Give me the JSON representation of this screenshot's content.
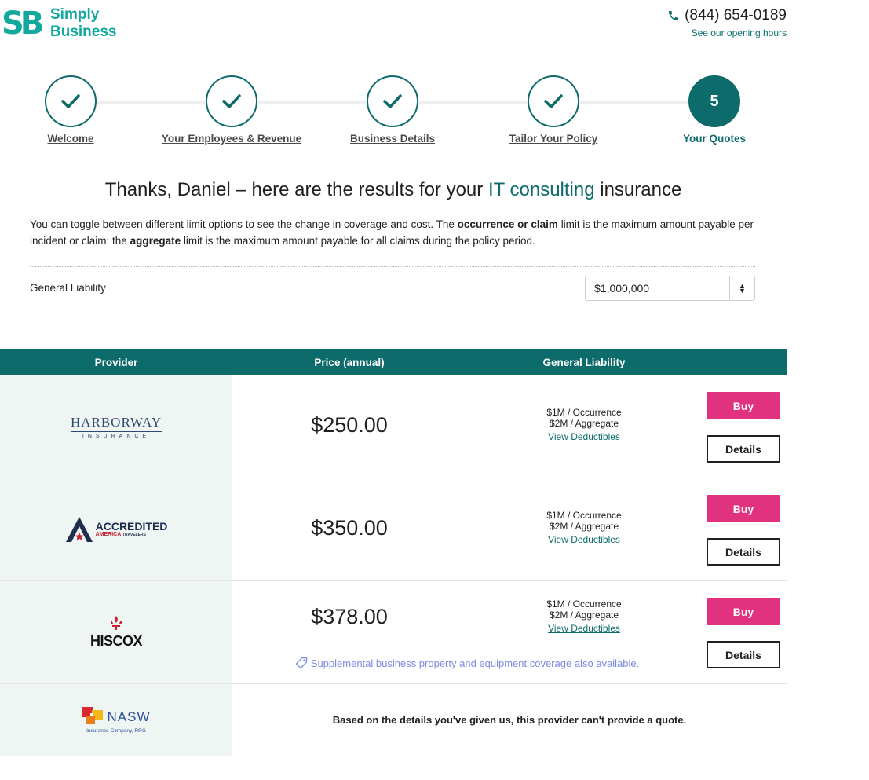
{
  "header": {
    "logo_mark": "SB",
    "logo_line1": "Simply",
    "logo_line2": "Business",
    "phone": "(844) 654-0189",
    "hours_link": "See our opening hours"
  },
  "stepper": {
    "steps": [
      {
        "label": "Welcome",
        "state": "complete"
      },
      {
        "label": "Your Employees & Revenue",
        "state": "complete"
      },
      {
        "label": "Business Details",
        "state": "complete"
      },
      {
        "label": "Tailor Your Policy",
        "state": "complete"
      },
      {
        "label": "Your Quotes",
        "state": "active",
        "number": "5"
      }
    ]
  },
  "title": {
    "prefix": "Thanks, Daniel – here are the results for your ",
    "highlight": "IT consulting",
    "suffix": " insurance"
  },
  "intro": {
    "part1": "You can toggle between different limit options to see the change in coverage and cost. The ",
    "bold1": "occurrence or claim",
    "part2": " limit is the maximum amount payable per incident or claim; the ",
    "bold2": "aggregate",
    "part3": " limit is the maximum amount payable for all claims during the policy period."
  },
  "limit_selector": {
    "label": "General Liability",
    "selected": "$1,000,000"
  },
  "table": {
    "headers": {
      "provider": "Provider",
      "price": "Price (annual)",
      "general_liability": "General Liability"
    },
    "rows": [
      {
        "provider": "Harborway Insurance",
        "logo_line1": "HARBORWAY",
        "logo_line2": "INSURANCE",
        "price": "$250.00",
        "occurrence": "$1M / Occurrence",
        "aggregate": "$2M / Aggregate",
        "deductibles_link": "View Deductibles",
        "buy": "Buy",
        "details": "Details"
      },
      {
        "provider": "Accredited America",
        "logo_line1": "ACCREDITED",
        "logo_line2": "AMERICA",
        "logo_line3": "TRAVELERS",
        "price": "$350.00",
        "occurrence": "$1M / Occurrence",
        "aggregate": "$2M / Aggregate",
        "deductibles_link": "View Deductibles",
        "buy": "Buy",
        "details": "Details"
      },
      {
        "provider": "Hiscox",
        "logo_line1": "HISCOX",
        "price": "$378.00",
        "occurrence": "$1M / Occurrence",
        "aggregate": "$2M / Aggregate",
        "deductibles_link": "View Deductibles",
        "supplemental": "Supplemental business property and equipment coverage also available.",
        "buy": "Buy",
        "details": "Details"
      },
      {
        "provider": "NASW Insurance Company, RRG",
        "logo_line1": "NASW",
        "logo_line2": "Insurance Company, RRG",
        "no_quote": "Based on the details you've given us, this provider can't provide a quote."
      }
    ]
  },
  "colors": {
    "brand_teal": "#0e6b6b",
    "logo_teal": "#12a89d",
    "buy_pink": "#e0327e",
    "provider_bg": "#eef5f3"
  }
}
